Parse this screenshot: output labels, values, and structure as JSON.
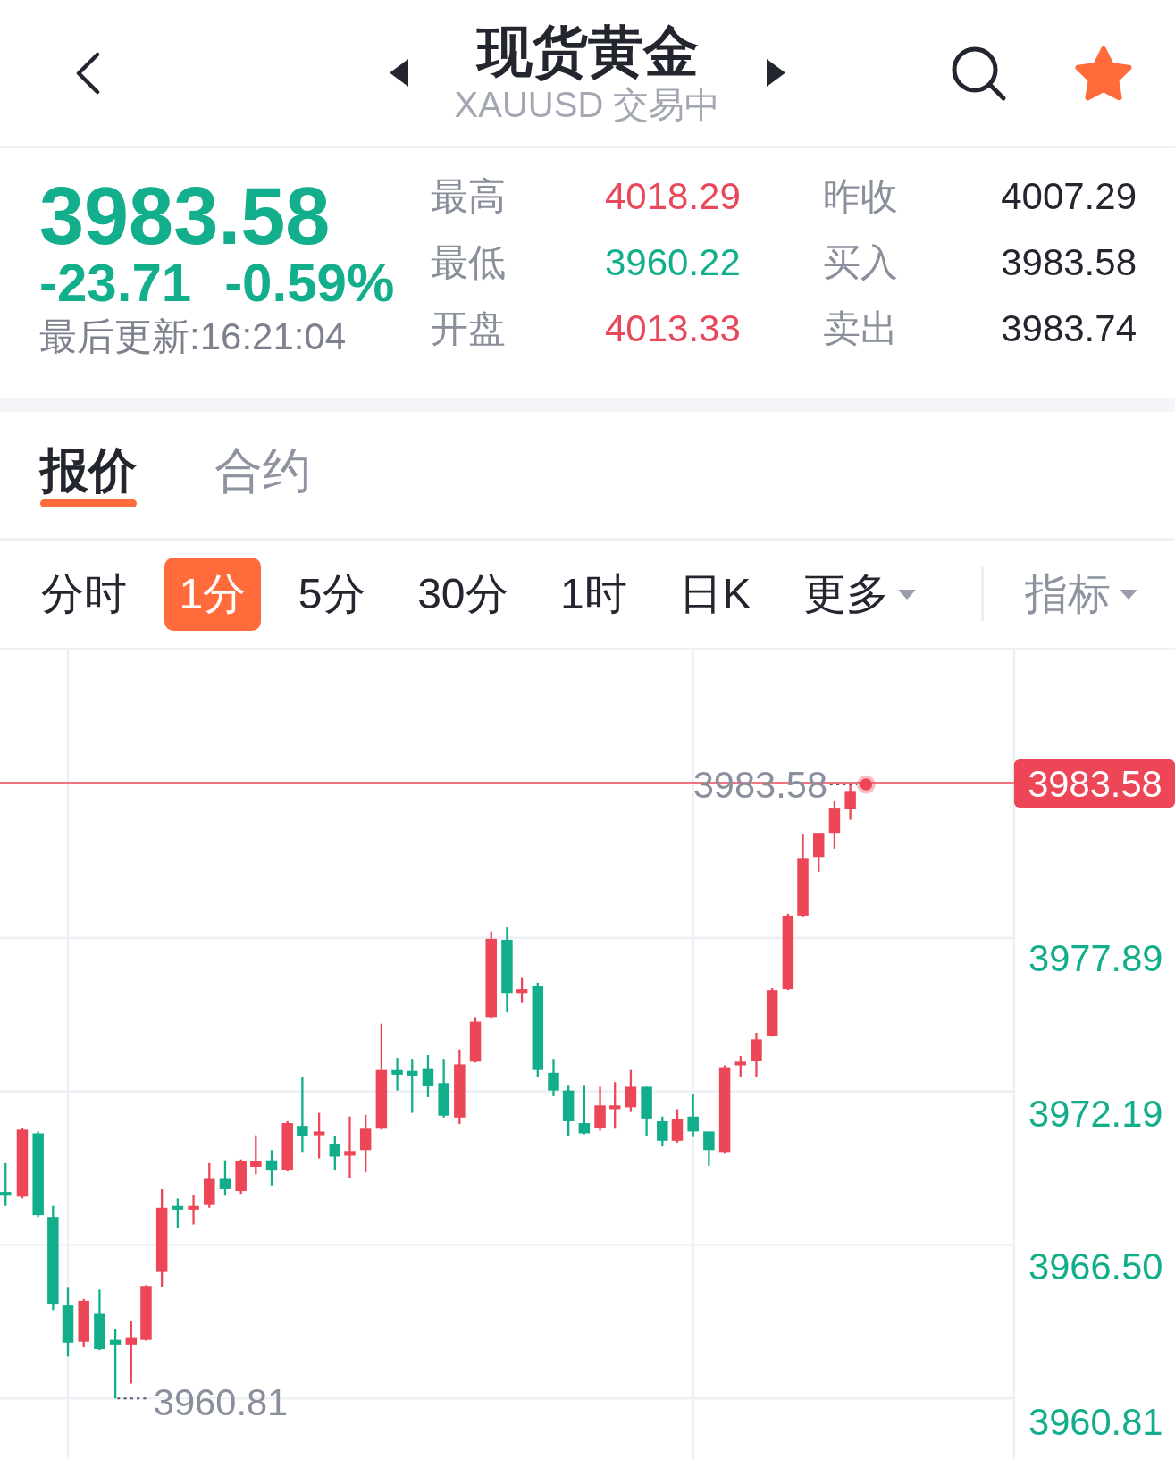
{
  "header": {
    "title": "现货黄金",
    "subtitle": "XAUUSD 交易中",
    "favorite": true
  },
  "quote": {
    "price": "3983.58",
    "change": "-23.71",
    "change_percent": "-0.59%",
    "updated": "最后更新:16:21:04",
    "falling": true
  },
  "stats": [
    {
      "label": "最高",
      "value": "4018.29",
      "color": "#e8495a"
    },
    {
      "label": "昨收",
      "value": "4007.29",
      "color": "#23262f"
    },
    {
      "label": "最低",
      "value": "3960.22",
      "color": "#13ae8b"
    },
    {
      "label": "买入",
      "value": "3983.58",
      "color": "#23262f"
    },
    {
      "label": "开盘",
      "value": "4013.33",
      "color": "#e8495a"
    },
    {
      "label": "卖出",
      "value": "3983.74",
      "color": "#23262f"
    }
  ],
  "tabs": [
    {
      "label": "报价",
      "selected": true
    },
    {
      "label": "合约",
      "selected": false
    }
  ],
  "periods": [
    {
      "label": "分时",
      "kind": "option",
      "selected": false
    },
    {
      "label": "1分",
      "kind": "option",
      "selected": true
    },
    {
      "label": "5分",
      "kind": "option",
      "selected": false
    },
    {
      "label": "30分",
      "kind": "option",
      "selected": false
    },
    {
      "label": "1时",
      "kind": "option",
      "selected": false
    },
    {
      "label": "日K",
      "kind": "option",
      "selected": false
    },
    {
      "label": "更多",
      "kind": "menu",
      "selected": false
    }
  ],
  "indicator": {
    "label": "指标"
  },
  "chart": {
    "price_badge": "3983.58",
    "last_price_label": "3983.58",
    "low_label": "3960.81",
    "axis_labels": [
      "3977.89",
      "3972.19",
      "3966.50",
      "3960.81"
    ]
  }
}
